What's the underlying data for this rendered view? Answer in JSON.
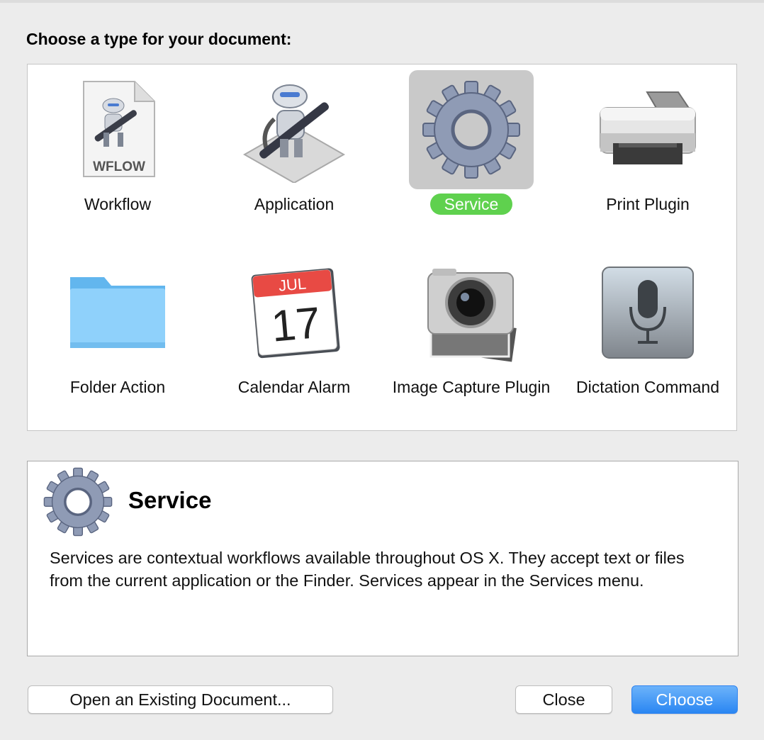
{
  "dialog": {
    "heading": "Choose a type for your document:"
  },
  "types": [
    {
      "label": "Workflow",
      "icon": "workflow-document-icon",
      "doc_badge": "WFLOW"
    },
    {
      "label": "Application",
      "icon": "automator-robot-icon"
    },
    {
      "label": "Service",
      "icon": "gear-icon",
      "selected": true
    },
    {
      "label": "Print Plugin",
      "icon": "printer-icon"
    },
    {
      "label": "Folder Action",
      "icon": "folder-icon"
    },
    {
      "label": "Calendar Alarm",
      "icon": "calendar-icon",
      "cal_month": "JUL",
      "cal_day": "17"
    },
    {
      "label": "Image Capture Plugin",
      "icon": "camera-icon"
    },
    {
      "label": "Dictation Command",
      "icon": "microphone-icon"
    }
  ],
  "description": {
    "title": "Service",
    "text": "Services are contextual workflows available throughout OS X. They accept text or files from the current application or the Finder. Services appear in the Services menu."
  },
  "buttons": {
    "open": "Open an Existing Document...",
    "close": "Close",
    "choose": "Choose"
  },
  "colors": {
    "selection_badge": "#5fd14e",
    "primary_button": "#2a86f2"
  }
}
